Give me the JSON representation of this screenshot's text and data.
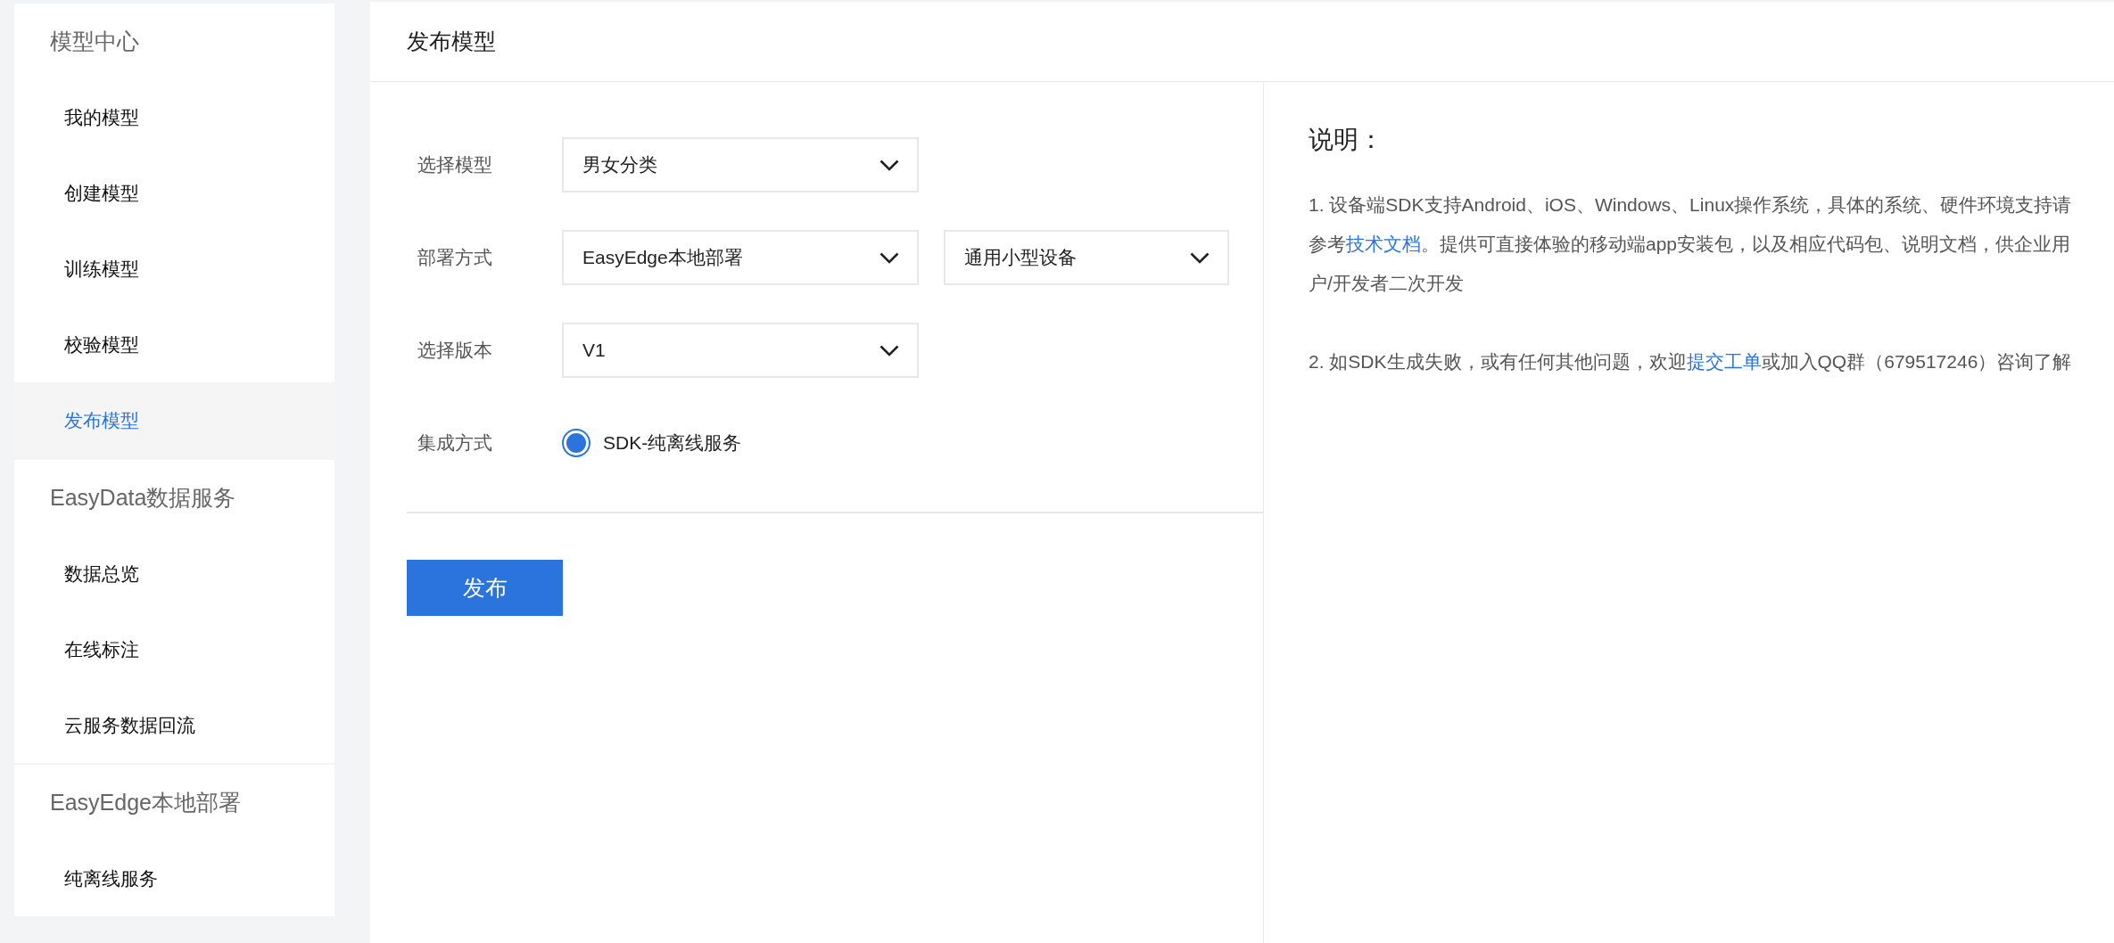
{
  "sidebar": {
    "groups": [
      {
        "title": "模型中心",
        "items": [
          {
            "label": "我的模型",
            "selected": false
          },
          {
            "label": "创建模型",
            "selected": false
          },
          {
            "label": "训练模型",
            "selected": false
          },
          {
            "label": "校验模型",
            "selected": false
          },
          {
            "label": "发布模型",
            "selected": true
          }
        ]
      },
      {
        "title": "EasyData数据服务",
        "items": [
          {
            "label": "数据总览",
            "selected": false
          },
          {
            "label": "在线标注",
            "selected": false
          },
          {
            "label": "云服务数据回流",
            "selected": false
          }
        ]
      },
      {
        "title": "EasyEdge本地部署",
        "items": [
          {
            "label": "纯离线服务",
            "selected": false
          }
        ]
      }
    ]
  },
  "page": {
    "title": "发布模型"
  },
  "form": {
    "rows": [
      {
        "label": "选择模型",
        "kind": "select",
        "selects": [
          {
            "value": "男女分类"
          }
        ]
      },
      {
        "label": "部署方式",
        "kind": "select",
        "selects": [
          {
            "value": "EasyEdge本地部署"
          },
          {
            "value": "通用小型设备"
          }
        ]
      },
      {
        "label": "选择版本",
        "kind": "select",
        "selects": [
          {
            "value": "V1"
          }
        ]
      },
      {
        "label": "集成方式",
        "kind": "radio",
        "options": [
          {
            "label": "SDK-纯离线服务",
            "selected": true
          }
        ]
      }
    ],
    "submit": "发布"
  },
  "notes": {
    "title": "说明：",
    "paragraphs": [
      [
        {
          "kind": "text",
          "text": "1. 设备端SDK支持Android、iOS、Windows、Linux操作系统，具体的系统、硬件环境支持请参考"
        },
        {
          "kind": "link",
          "text": "技术文档"
        },
        {
          "kind": "text",
          "text": "。提供可直接体验的移动端app安装包，以及相应代码包、说明文档，供企业用户/开发者二次开发"
        }
      ],
      [
        {
          "kind": "text",
          "text": "2. 如SDK生成失败，或有任何其他问题，欢迎"
        },
        {
          "kind": "link",
          "text": "提交工单"
        },
        {
          "kind": "text",
          "text": "或加入QQ群（679517246）咨询了解"
        }
      ]
    ]
  }
}
